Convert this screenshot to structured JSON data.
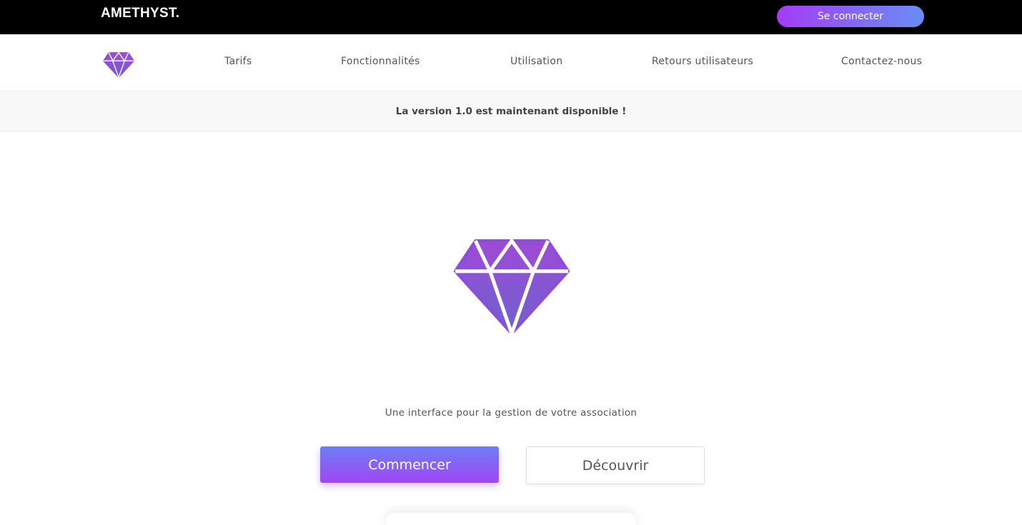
{
  "header": {
    "brand": "AMETHYST.",
    "login_label": "Se connecter"
  },
  "nav": {
    "logo_icon": "diamond-icon",
    "items": [
      {
        "label": "Tarifs"
      },
      {
        "label": "Fonctionnalités"
      },
      {
        "label": "Utilisation"
      },
      {
        "label": "Retours utilisateurs"
      },
      {
        "label": "Contactez-nous"
      }
    ]
  },
  "announcement": {
    "text": "La version 1.0 est maintenant disponible !"
  },
  "hero": {
    "icon": "diamond-icon",
    "tagline": "Une interface pour la gestion de votre association",
    "primary_button": "Commencer",
    "secondary_button": "Découvrir"
  },
  "colors": {
    "gradient_start": "#a43cf5",
    "gradient_end": "#6a8df4",
    "topbar": "#000000"
  }
}
